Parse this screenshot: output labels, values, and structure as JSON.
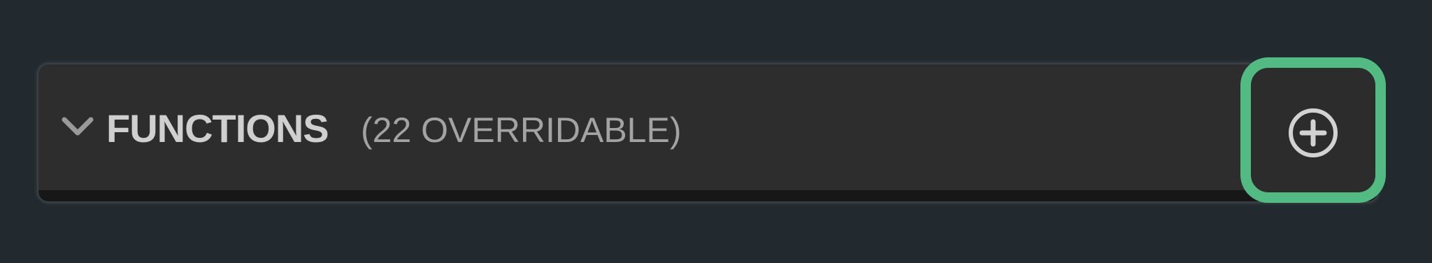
{
  "section": {
    "title": "FUNCTIONS",
    "count_label": "(22 OVERRIDABLE)",
    "collapse_icon": "chevron-down-icon",
    "add_icon": "plus-circle-icon"
  },
  "colors": {
    "background": "#232a2f",
    "panel": "#2d2d2d",
    "highlight": "#52bb82",
    "title_text": "#cfcfcf",
    "count_text": "#a3a3a3"
  }
}
